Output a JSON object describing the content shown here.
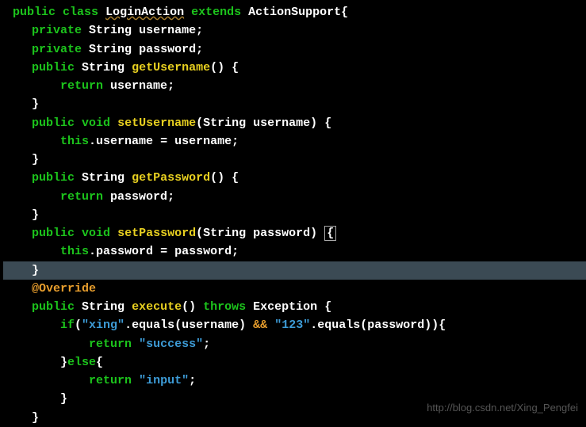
{
  "code": {
    "class_decl_public": "public",
    "class_decl_class": "class",
    "class_name": "LoginAction",
    "class_extends": "extends",
    "super_class": "ActionSupport",
    "private_kw": "private",
    "string_type": "String",
    "field_username": "username",
    "field_password": "password",
    "public_kw": "public",
    "void_kw": "void",
    "get_username": "getUsername",
    "set_username": "setUsername",
    "get_password": "getPassword",
    "set_password": "setPassword",
    "return_kw": "return",
    "this_kw": "this",
    "override": "@Override",
    "execute": "execute",
    "throws_kw": "throws",
    "exception": "Exception",
    "if_kw": "if",
    "else_kw": "else",
    "equals_method": "equals",
    "and_op": "&&",
    "str_xing": "\"xing\"",
    "str_123": "\"123\"",
    "str_success": "\"success\"",
    "str_input": "\"input\"",
    "lb": "{",
    "rb": "}",
    "lp": "(",
    "rp": ")",
    "semi": ";",
    "dot": ".",
    "eq": "=",
    "param_username": "username",
    "param_password": "password"
  },
  "watermark": "http://blog.csdn.net/Xing_Pengfei"
}
